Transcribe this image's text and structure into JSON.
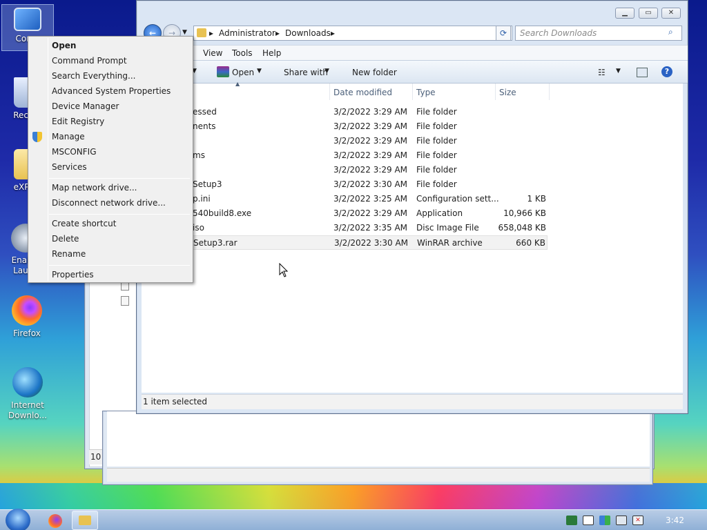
{
  "desktop": {
    "icons": [
      {
        "label": "Comp",
        "icon": "computer-icon"
      },
      {
        "label": "Recyc",
        "icon": "recycle-bin-icon"
      },
      {
        "label": "eXPer",
        "icon": "folder-icon"
      },
      {
        "label": "Enable Launc",
        "icon": "launcher-icon"
      },
      {
        "label": "Firefox",
        "icon": "firefox-icon"
      },
      {
        "label": "Internet Downlo...",
        "icon": "internet-download-manager-icon"
      }
    ]
  },
  "background_window": {
    "status_text": "10"
  },
  "explorer": {
    "breadcrumb": [
      "Administrator",
      "Downloads"
    ],
    "search_placeholder": "Search Downloads",
    "menu": [
      "View",
      "Tools",
      "Help"
    ],
    "toolbar": {
      "open": "Open",
      "share_with": "Share with",
      "new_folder": "New folder"
    },
    "columns": {
      "date_modified": "Date modified",
      "type": "Type",
      "size": "Size"
    },
    "files": [
      {
        "name": "essed",
        "date": "3/2/2022 3:29 AM",
        "type": "File folder",
        "size": ""
      },
      {
        "name": "nents",
        "date": "3/2/2022 3:29 AM",
        "type": "File folder",
        "size": ""
      },
      {
        "name": "",
        "date": "3/2/2022 3:29 AM",
        "type": "File folder",
        "size": ""
      },
      {
        "name": "ms",
        "date": "3/2/2022 3:29 AM",
        "type": "File folder",
        "size": ""
      },
      {
        "name": "",
        "date": "3/2/2022 3:29 AM",
        "type": "File folder",
        "size": ""
      },
      {
        "name": "Setup3",
        "date": "3/2/2022 3:30 AM",
        "type": "File folder",
        "size": ""
      },
      {
        "name": "p.ini",
        "date": "3/2/2022 3:25 AM",
        "type": "Configuration sett...",
        "size": "1 KB"
      },
      {
        "name": "540build8.exe",
        "date": "3/2/2022 3:29 AM",
        "type": "Application",
        "size": "10,966 KB"
      },
      {
        "name": "iso",
        "date": "3/2/2022 3:35 AM",
        "type": "Disc Image File",
        "size": "658,048 KB"
      },
      {
        "name": "Setup3.rar",
        "date": "3/2/2022 3:30 AM",
        "type": "WinRAR archive",
        "size": "660 KB"
      }
    ],
    "selected_row_index": 9,
    "status": "1 item selected"
  },
  "context_menu": {
    "items": [
      "Open",
      "Command Prompt",
      "Search Everything...",
      "Advanced System Properties",
      "Device Manager",
      "Edit Registry",
      "Manage",
      "MSCONFIG",
      "Services",
      "Map network drive...",
      "Disconnect network drive...",
      "Create shortcut",
      "Delete",
      "Rename",
      "Properties"
    ]
  },
  "taskbar": {
    "clock": "3:42",
    "pinned": [
      "start-orb-icon",
      "firefox-icon",
      "explorer-folder-icon"
    ]
  },
  "colors": {
    "accent": "#3399ff",
    "selection": "#f2f2f2",
    "taskbar": "#a9c2e2"
  }
}
